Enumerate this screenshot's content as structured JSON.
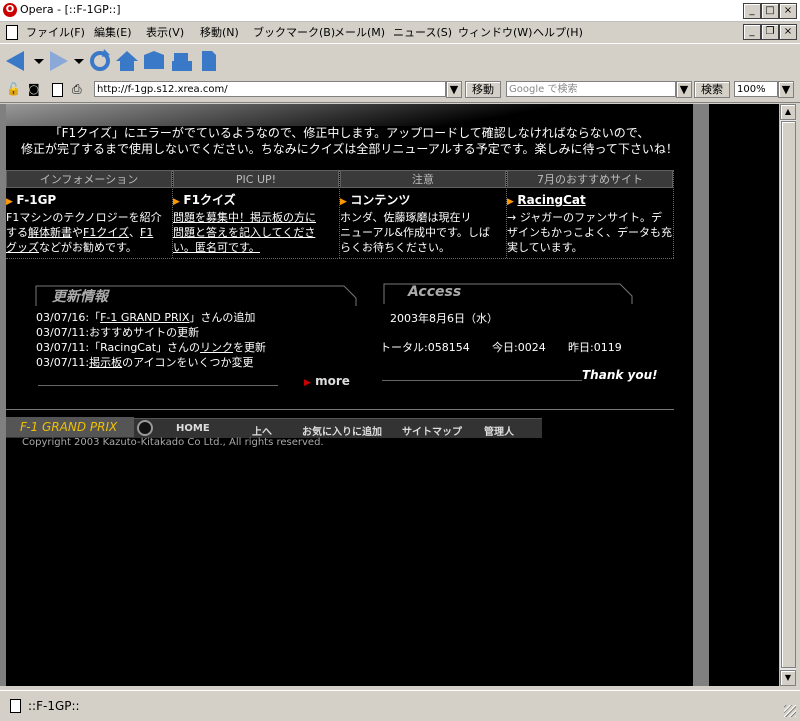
{
  "window": {
    "title": "Opera - [::F-1GP::]",
    "app_icon": "O"
  },
  "menu": [
    "ファイル(F)",
    "編集(E)",
    "表示(V)",
    "移動(N)",
    "ブックマーク(B)",
    "メール(M)",
    "ニュース(S)",
    "ウィンドウ(W)",
    "ヘルプ(H)"
  ],
  "address": {
    "url": "http://f-1gp.s12.xrea.com/",
    "go_label": "移動",
    "search_placeholder": "Google で検索",
    "search_label": "検索",
    "zoom": "100%"
  },
  "page": {
    "notice_line1": "「F1クイズ」にエラーがでているようなので、修正中します。アップロードして確認しなければならないので、",
    "notice_line2": "修正が完了するまで使用しないでください。ちなみにクイズは全部リニューアルする予定です。楽しみに待って下さいね！",
    "columns": [
      {
        "head": "インフォメーション",
        "title": "F-1GP",
        "l1": "F1マシンのテクノロジーを紹介",
        "l2a": "する",
        "l2b": "解体新書",
        "l2c": "や",
        "l2d": "F1クイズ",
        "l2e": "、",
        "l2f": "F1",
        "l3a": "グッズ",
        "l3b": "などがお勧めです。"
      },
      {
        "head": "PIC UP!",
        "title": "F1クイズ",
        "l1": "問題を募集中！掲示板の方に",
        "l2": "問題と答えを記入してくださ",
        "l3": "い。匿名可です。"
      },
      {
        "head": "注意",
        "title": "コンテンツ",
        "l1": "ホンダ、佐藤琢磨は現在リ",
        "l2": "ニューアル&作成中です。しば",
        "l3": "らくお待ちください。"
      },
      {
        "head": "7月のおすすめサイト",
        "title": "RacingCat",
        "l1": "→ ジャガーのファンサイト。デ",
        "l2": "ザインもかっこよく、データも充",
        "l3": "実しています。"
      }
    ],
    "updates": {
      "title": "更新情報",
      "items": [
        {
          "a": "03/07/16:「",
          "link": "F-1 GRAND PRIX",
          "b": "」さんの追加"
        },
        {
          "a": "03/07/11:おすすめサイトの更新",
          "link": "",
          "b": ""
        },
        {
          "a": "03/07/11:「RacingCat」さんの",
          "link": "リンク",
          "b": "を更新"
        },
        {
          "a": "03/07/11:",
          "link": "掲示板",
          "b": "のアイコンをいくつか変更"
        }
      ],
      "more": "more"
    },
    "access": {
      "title": "Access",
      "date": "2003年8月6日（水）",
      "total": "トータル:058154",
      "today": "今日:0024",
      "yesterday": "昨日:0119",
      "thanks": "Thank you!"
    },
    "footer": {
      "logo": "F-1 GRAND PRIX",
      "links": [
        "HOME",
        "上へ",
        "お気に入りに追加",
        "サイトマップ",
        "管理人"
      ],
      "copyright": "Copyright 2003 Kazuto-Kitakado Co Ltd., All rights reserved."
    }
  },
  "status": {
    "text": "::F-1GP::"
  }
}
